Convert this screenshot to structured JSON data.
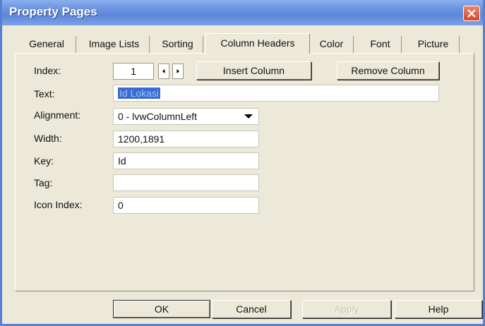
{
  "window": {
    "title": "Property Pages"
  },
  "tabs": [
    "General",
    "Image Lists",
    "Sorting",
    "Column Headers",
    "Color",
    "Font",
    "Picture"
  ],
  "active_tab": "Column Headers",
  "index": {
    "label": "Index:",
    "value": "1",
    "insert_label": "Insert Column",
    "remove_label": "Remove Column"
  },
  "fields": {
    "text": {
      "label": "Text:",
      "value": "Id Lokasi"
    },
    "alignment": {
      "label": "Alignment:",
      "value": "0 - lvwColumnLeft"
    },
    "width": {
      "label": "Width:",
      "value": "1200,1891"
    },
    "key": {
      "label": "Key:",
      "value": "Id"
    },
    "tag": {
      "label": "Tag:",
      "value": ""
    },
    "icon_index": {
      "label": "Icon Index:",
      "value": "0"
    }
  },
  "buttons": {
    "ok": "OK",
    "cancel": "Cancel",
    "apply": "Apply",
    "help": "Help"
  },
  "colors": {
    "titlebar": "#6c93e0",
    "close": "#d9573a",
    "selection": "#3a6ad4",
    "dialog": "#ece9d8"
  }
}
